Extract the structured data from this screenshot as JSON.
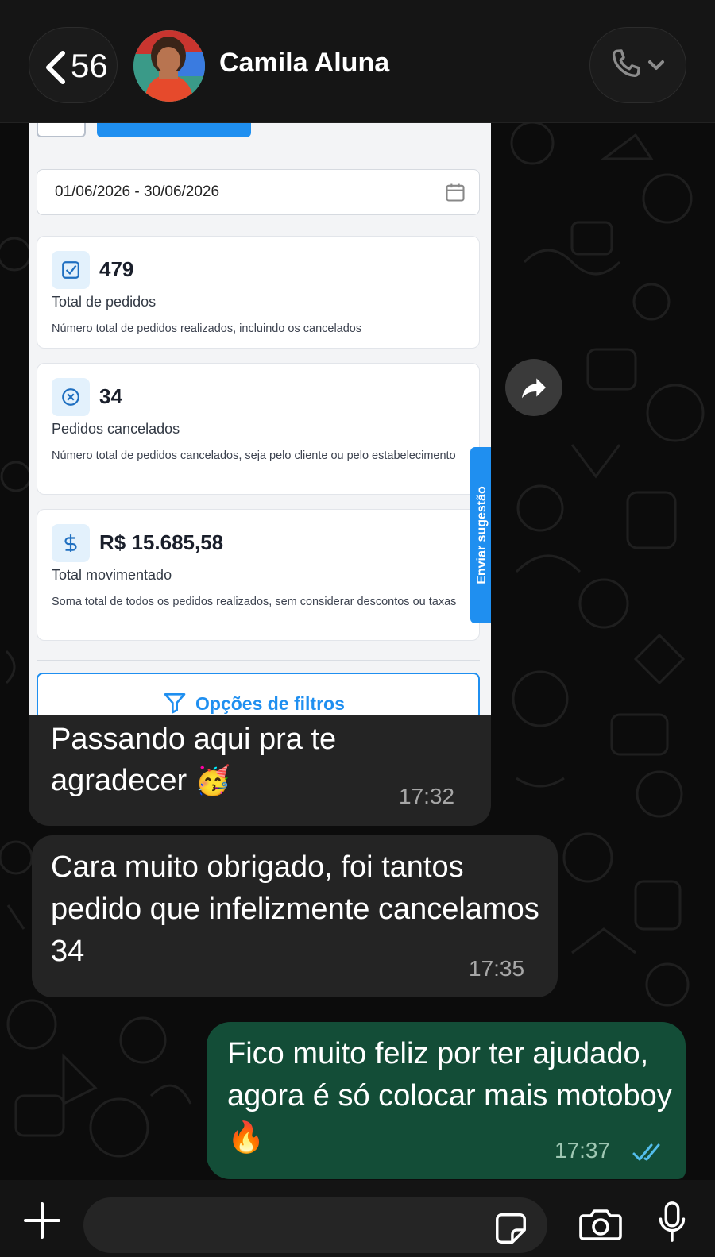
{
  "header": {
    "back_count": "56",
    "contact_name": "Camila Aluna"
  },
  "image_message": {
    "date_range": "01/06/2026 - 30/06/2026",
    "stats": [
      {
        "value": "479",
        "label": "Total de pedidos",
        "description": "Número total de pedidos realizados, incluindo os cancelados"
      },
      {
        "value": "34",
        "label": "Pedidos cancelados",
        "description": "Número total de pedidos cancelados, seja pelo cliente ou pelo estabelecimento"
      },
      {
        "value": "R$ 15.685,58",
        "label": "Total movimentado",
        "description": "Soma total de todos os pedidos realizados, sem considerar descontos ou taxas"
      }
    ],
    "suggestion_tab": "Enviar sugestão",
    "filter_button": "Opções de filtros",
    "caption": "Passando aqui pra te agradecer",
    "caption_emoji": "🥳",
    "time": "17:32"
  },
  "messages": [
    {
      "direction": "incoming",
      "text": "Cara muito obrigado, foi tantos pedido que infelizmente cancelamos 34",
      "time": "17:35"
    },
    {
      "direction": "outgoing",
      "text": "Fico muito feliz por ter ajudado, agora é só colocar mais motoboy",
      "emoji": "🔥",
      "time": "17:37",
      "status": "read"
    }
  ],
  "colors": {
    "outgoing_bubble": "#134d37",
    "incoming_bubble": "#242424",
    "accent_blue": "#1f8ff0",
    "read_tick": "#53bdeb"
  },
  "icons": [
    "chevron-left-icon",
    "phone-icon",
    "chevron-down-icon",
    "forward-icon",
    "calendar-icon",
    "check-square-icon",
    "x-circle-icon",
    "dollar-icon",
    "filter-icon",
    "plus-icon",
    "sticker-icon",
    "camera-icon",
    "mic-icon",
    "double-check-icon"
  ]
}
